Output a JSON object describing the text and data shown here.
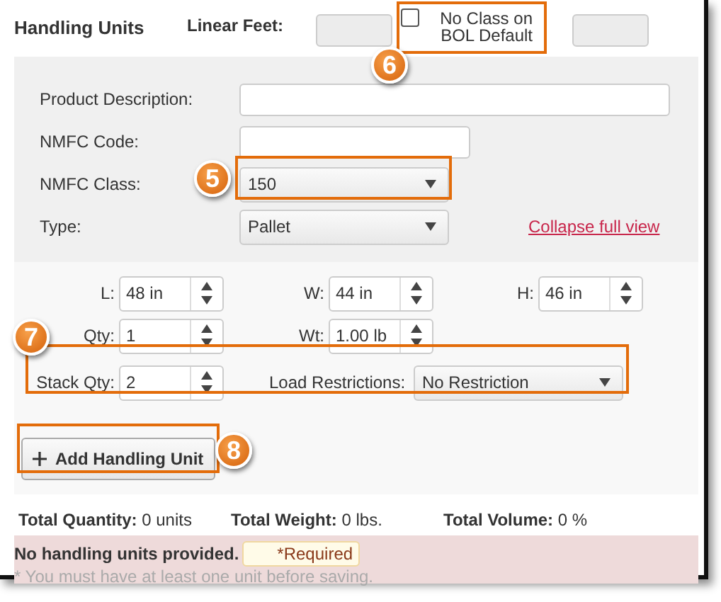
{
  "header": {
    "title": "Handling Units",
    "linear_feet_label": "Linear Feet:",
    "no_class": {
      "label": "No Class on BOL Default",
      "checked": false
    }
  },
  "details": {
    "fields": [
      {
        "kind": "text",
        "label": "Product Description:"
      },
      {
        "kind": "text",
        "label": "NMFC Code:"
      },
      {
        "kind": "select",
        "label": "NMFC Class:",
        "value": "150"
      },
      {
        "kind": "select",
        "label": "Type:",
        "value": "Pallet"
      }
    ],
    "collapse_link": "Collapse full view"
  },
  "measures": {
    "rows": [
      [
        {
          "label": "L:",
          "value": "48 in"
        },
        {
          "label": "W:",
          "value": "44 in"
        },
        {
          "label": "H:",
          "value": "46 in"
        }
      ],
      [
        {
          "label": "Qty:",
          "value": "1"
        },
        {
          "label": "Wt:",
          "value": "1.00 lb"
        }
      ]
    ],
    "stack_qty": {
      "label": "Stack Qty:",
      "value": "2"
    },
    "load_restrictions": {
      "label": "Load Restrictions:",
      "value": "No Restriction"
    }
  },
  "add_button": "Add Handling Unit",
  "totals": [
    {
      "label": "Total Quantity:",
      "value": "0 units"
    },
    {
      "label": "Total Weight:",
      "value": "0 lbs."
    },
    {
      "label": "Total Volume:",
      "value": "0 %"
    }
  ],
  "error": {
    "message": "No handling units provided.",
    "required": "*Required",
    "note": "* You must have at least one unit before saving."
  },
  "callouts": [
    "6",
    "5",
    "7",
    "8"
  ]
}
